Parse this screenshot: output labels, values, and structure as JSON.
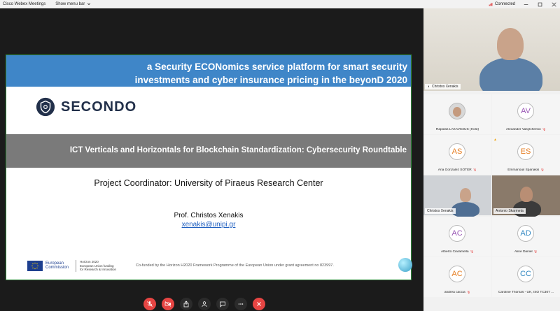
{
  "titlebar": {
    "app_name": "Cisco Webex Meetings",
    "menu_label": "Show menu bar",
    "status": "Connected"
  },
  "slide": {
    "title_line1": "a Security ECONomics service platform for smart security",
    "title_line2": "investments and cyber insurance pricing in the beyonD 2020",
    "brand": "SECONDO",
    "band_text": "ICT Verticals and Horizontals for Blockchain Standardization: Cybersecurity Roundtable",
    "coordinator": "Project Coordinator: University of Piraeus Research Center",
    "presenter": "Prof. Christos Xenakis",
    "email": "xenakis@unipi.gr",
    "ec_line1": "European",
    "ec_line2": "Commission",
    "h2020_line1": "Horizon 2020",
    "h2020_line2": "European Union funding",
    "h2020_line3": "for Research & Innovation",
    "cofund": "Co-funded by the Horizon H2020 Framework Programme of the European Union under grant agreement no 823997."
  },
  "participants": {
    "active_speaker": "Christos Xenakis",
    "tiles": [
      {
        "name": "Rapolas LAKAVIČIUS (Host)",
        "initials": "",
        "color": "#e8e8e8"
      },
      {
        "name": "Alexander Vasylchenko",
        "initials": "AV",
        "color": "#9b59b6"
      },
      {
        "name": "Ana Gonzalez SOTER",
        "initials": "AS",
        "color": "#e67e22"
      },
      {
        "name": "Emmanouil Spanakis",
        "initials": "ES",
        "color": "#e67e22"
      },
      {
        "name": "Christos Xenakis",
        "initials": "",
        "color": ""
      },
      {
        "name": "Antonio Skarmeta",
        "initials": "",
        "color": ""
      },
      {
        "name": "Alberto Ciaramella",
        "initials": "AC",
        "color": "#9b59b6"
      },
      {
        "name": "Aline Daniel",
        "initials": "AD",
        "color": "#2e86c1"
      },
      {
        "name": "andrea caccia",
        "initials": "AC",
        "color": "#e67e22"
      },
      {
        "name": "Caroline Thomas - UK, ISO TC307 ...",
        "initials": "CC",
        "color": "#2e86c1"
      }
    ]
  },
  "colors": {
    "banner": "#3f86c8",
    "band": "#7a7a7a",
    "end_button": "#e64543",
    "brand": "#22304a"
  }
}
